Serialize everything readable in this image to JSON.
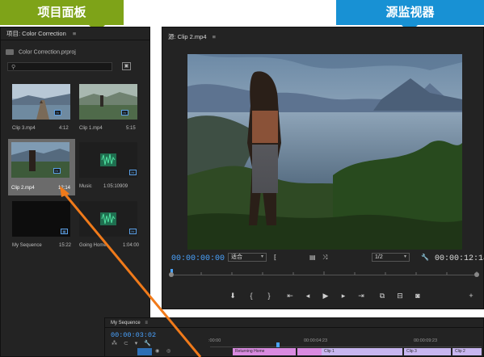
{
  "banners": {
    "project": "项目面板",
    "source": "源监视器"
  },
  "project_panel": {
    "title": "项目: Color Correction",
    "menu_icon": "≡",
    "file_name": "Color Correction.prproj",
    "clips": [
      {
        "name": "Clip 3.mp4",
        "duration": "4:12",
        "badge": "Hr"
      },
      {
        "name": "Clip 1.mp4",
        "duration": "5:15",
        "badge": "Hr"
      },
      {
        "name": "Clip 2.mp4",
        "duration": "12:14",
        "badge": "Hr",
        "selected": true
      },
      {
        "name": "Music",
        "duration": "1:05:10909",
        "badge": "Hr"
      },
      {
        "name": "My Sequence",
        "duration": "15:22",
        "badge": ""
      },
      {
        "name": "Going Home",
        "duration": "1:04:00",
        "badge": "Hr"
      }
    ]
  },
  "source_panel": {
    "title": "源: Clip 2.mp4",
    "menu_icon": "≡",
    "current_timecode": "00:00:00:00",
    "end_timecode": "00:00:12:14",
    "fit_label": "适合",
    "resolution_label": "1/2"
  },
  "timeline": {
    "title": "My Sequence",
    "menu_icon": "≡",
    "timecode": "00:00:03:02",
    "ruler_times": [
      ":00:00",
      "00:00:04:23",
      "00:00:09:23"
    ],
    "clips": [
      {
        "label": "Returning Home",
        "color": "#d98be0"
      },
      {
        "label": "Clip 1",
        "color": "#c8b6f0"
      },
      {
        "label": "Clip 3",
        "color": "#c8b6f0"
      },
      {
        "label": "Clip 2",
        "color": "#c8b6f0"
      }
    ]
  },
  "colors": {
    "project_banner": "#7ea318",
    "source_banner": "#1891d4",
    "accent_blue": "#4aa3ff",
    "annotation_arrow": "#f07a1a",
    "panel_bg": "#232323"
  }
}
